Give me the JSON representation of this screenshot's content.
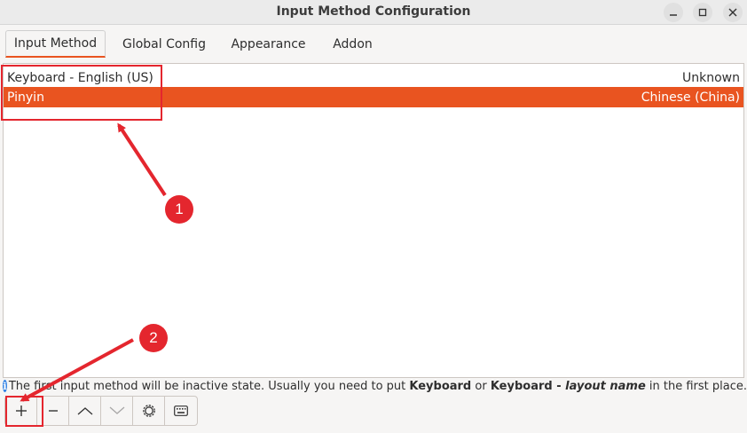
{
  "window": {
    "title": "Input Method Configuration"
  },
  "tabs": [
    {
      "label": "Input Method",
      "active": true
    },
    {
      "label": "Global Config",
      "active": false
    },
    {
      "label": "Appearance",
      "active": false
    },
    {
      "label": "Addon",
      "active": false
    }
  ],
  "input_methods": [
    {
      "name": "Keyboard - English (US)",
      "language": "Unknown",
      "selected": false
    },
    {
      "name": "Pinyin",
      "language": "Chinese (China)",
      "selected": true
    }
  ],
  "info": {
    "text_1": "The first input method will be inactive state. Usually you need to put ",
    "bold_1": "Keyboard",
    "text_2": " or ",
    "bold_2": "Keyboard - ",
    "italic": "layout name",
    "text_3": " in the first place."
  },
  "toolbar": {
    "buttons": [
      "add-icon",
      "remove-icon",
      "move-up-icon",
      "move-down-icon",
      "configure-icon",
      "keyboard-layout-icon"
    ]
  },
  "annotations": {
    "badge_1": "1",
    "badge_2": "2",
    "color": "#e4262e"
  },
  "colors": {
    "accent": "#e95420",
    "info_icon": "#3584e4"
  }
}
